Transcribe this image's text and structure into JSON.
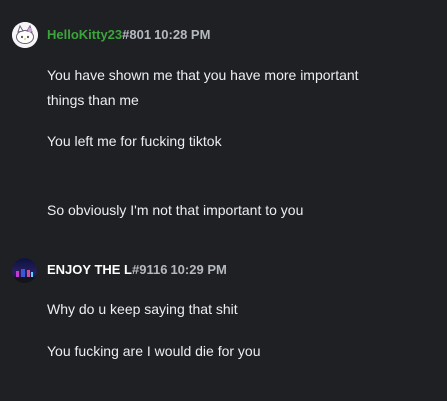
{
  "colors": {
    "background": "#1f2023",
    "text": "#eceef1",
    "muted": "#b5b9bf",
    "user1_name": "#3ba53b",
    "user2_name": "#ffffff"
  },
  "messages": [
    {
      "avatar_icon": "hello-kitty-avatar-icon",
      "username": "HelloKitty23",
      "discriminator": "#801",
      "time": "10:28 PM",
      "lines": [
        "You have shown me that you have more important",
        "things than me",
        "You left me for fucking tiktok",
        "So obviously I'm not that important to you"
      ]
    },
    {
      "avatar_icon": "night-scene-avatar-icon",
      "username": "ENJOY THE L",
      "discriminator": "#9116",
      "time": "10:29 PM",
      "lines": [
        "Why do u keep saying that shit",
        "You fucking are I would die for you"
      ]
    }
  ]
}
